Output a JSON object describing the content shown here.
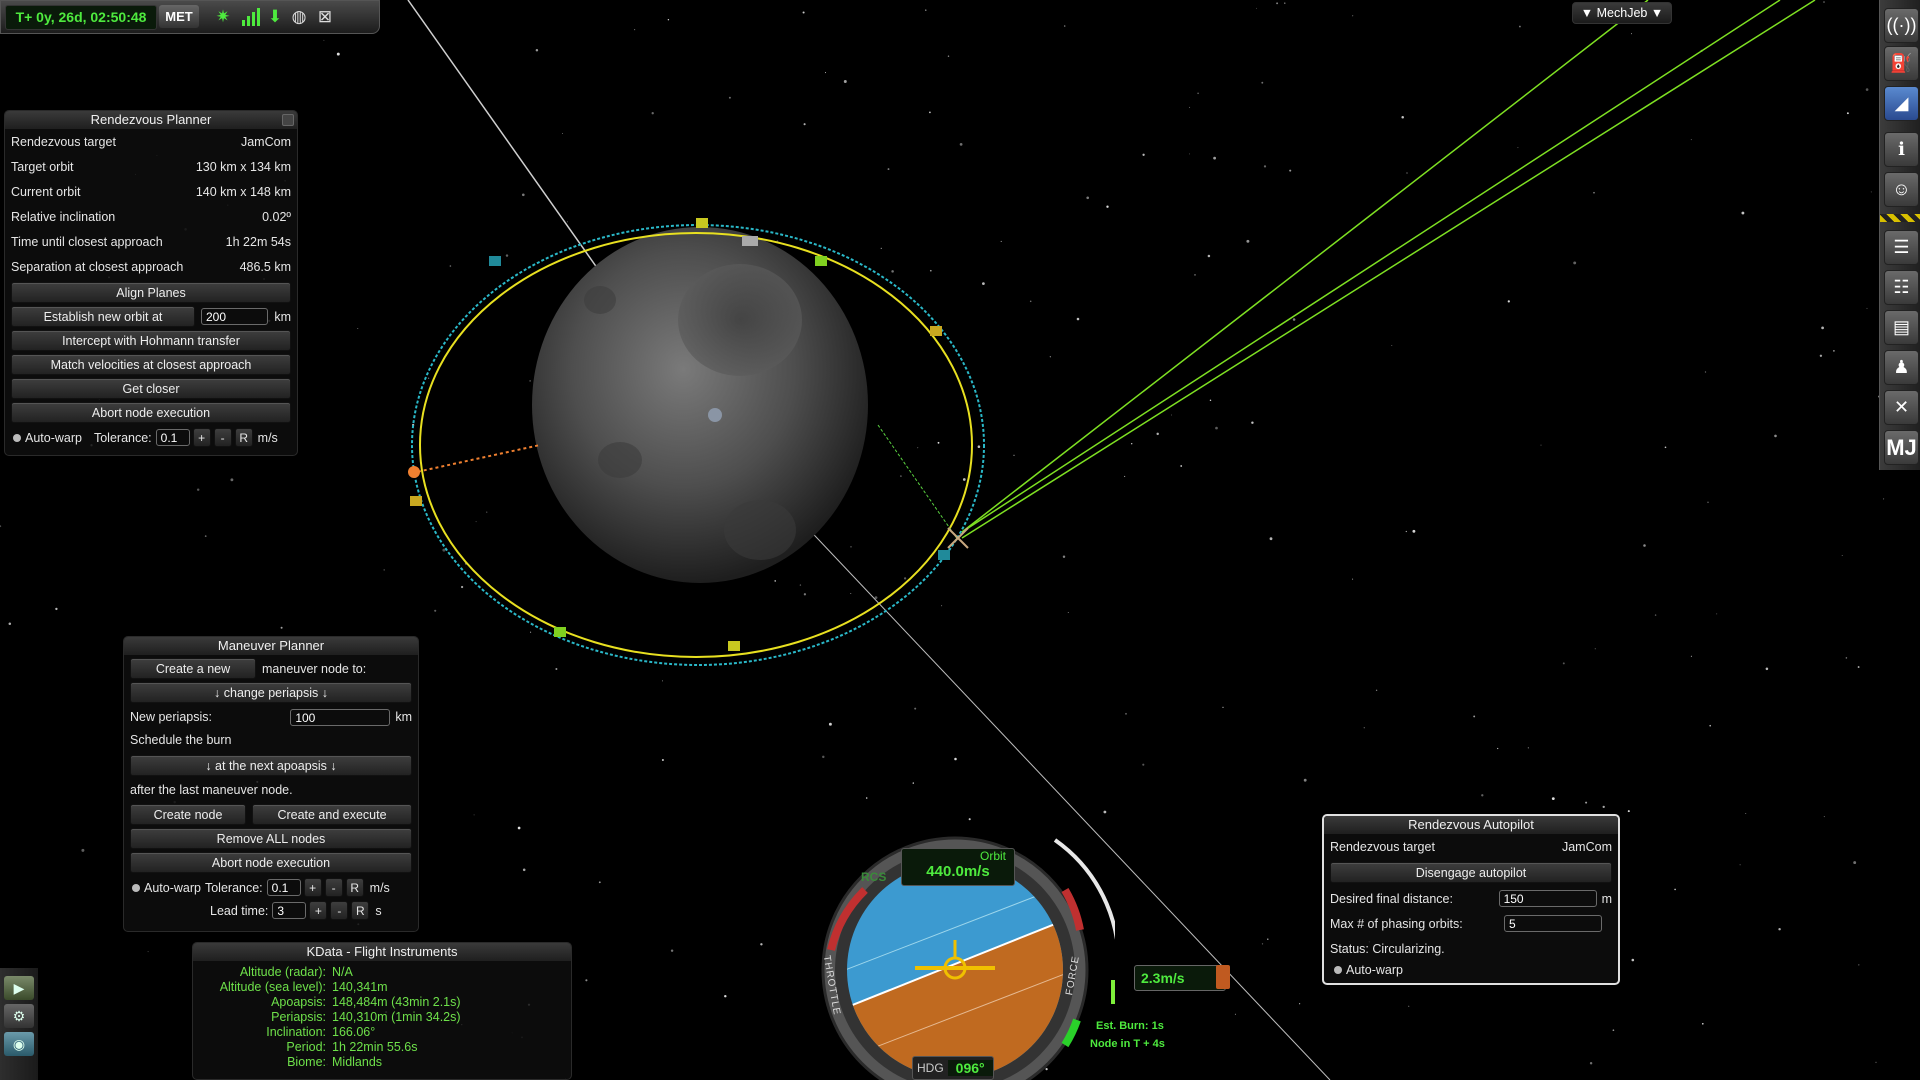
{
  "topbar": {
    "met_time": "T+ 0y, 26d, 02:50:48",
    "met_label": "MET",
    "icons": [
      "antenna-signal-icon",
      "signal-bars-icon",
      "download-arrow-icon",
      "planet-view-icon",
      "map-navigation-icon"
    ]
  },
  "mechjeb_tab": {
    "label": "▼ MechJeb ▼"
  },
  "rendezvous_planner": {
    "title": "Rendezvous Planner",
    "rows": [
      {
        "label": "Rendezvous target",
        "value": "JamCom"
      },
      {
        "label": "Target orbit",
        "value": "130 km x 134 km"
      },
      {
        "label": "Current orbit",
        "value": "140 km x 148 km"
      },
      {
        "label": "Relative inclination",
        "value": "0.02º"
      },
      {
        "label": "Time until closest approach",
        "value": "1h 22m 54s"
      },
      {
        "label": "Separation at closest approach",
        "value": "486.5 km"
      }
    ],
    "align_planes": "Align Planes",
    "establish_label": "Establish new orbit at",
    "establish_value": "200",
    "establish_unit": "km",
    "hohmann": "Intercept with Hohmann transfer",
    "match_velocities": "Match velocities at closest approach",
    "get_closer": "Get closer",
    "abort": "Abort node execution",
    "autowarp": "Auto-warp",
    "tolerance_label": "Tolerance:",
    "tolerance_value": "0.1",
    "plus": "+",
    "minus": "-",
    "reset": "R",
    "tolerance_unit": "m/s"
  },
  "maneuver_planner": {
    "title": "Maneuver Planner",
    "create_new": "Create a new",
    "node_to": "maneuver node to:",
    "change_periapsis": "↓ change periapsis ↓",
    "new_periapsis_label": "New periapsis:",
    "new_periapsis_value": "100",
    "new_periapsis_unit": "km",
    "schedule": "Schedule the burn",
    "next_apoapsis": "↓ at the next apoapsis ↓",
    "after_last": "after the last maneuver node.",
    "create_node": "Create node",
    "create_execute": "Create and execute",
    "remove_all": "Remove ALL nodes",
    "abort": "Abort node execution",
    "autowarp": "Auto-warp",
    "tolerance_label": "Tolerance:",
    "tolerance_value": "0.1",
    "plus": "+",
    "minus": "-",
    "reset": "R",
    "tolerance_unit": "m/s",
    "lead_label": "Lead time:",
    "lead_value": "3",
    "lead_unit": "s"
  },
  "rendezvous_autopilot": {
    "title": "Rendezvous Autopilot",
    "target_label": "Rendezvous target",
    "target_value": "JamCom",
    "disengage": "Disengage autopilot",
    "final_distance_label": "Desired final distance:",
    "final_distance_value": "150",
    "final_distance_unit": "m",
    "phasing_label": "Max # of phasing orbits:",
    "phasing_value": "5",
    "status": "Status: Circularizing.",
    "autowarp": "Auto-warp"
  },
  "kdata": {
    "title": "KData - Flight Instruments",
    "rows": [
      {
        "label": "Altitude (radar):",
        "value": "N/A"
      },
      {
        "label": "Altitude (sea level):",
        "value": "140,341m"
      },
      {
        "label": "Apoapsis:",
        "value": "148,484m (43min 2.1s)"
      },
      {
        "label": "Periapsis:",
        "value": "140,310m (1min 34.2s)"
      },
      {
        "label": "Inclination:",
        "value": "166.06°"
      },
      {
        "label": "Period:",
        "value": "1h 22min 55.6s"
      },
      {
        "label": "Biome:",
        "value": "Midlands"
      }
    ]
  },
  "navball": {
    "mode": "Orbit",
    "speed": "440.0m/s",
    "rcs": "RCS",
    "throttle_label": "THROTTLE",
    "force_label": "FORCE",
    "heading_label": "HDG",
    "heading_value": "096°",
    "burn_dv": "2.3m/s",
    "est_burn": "Est. Burn: 1s",
    "node_in": "Node in T + 4s"
  },
  "colors": {
    "met_green": "#4eea3e",
    "orbit_yellow": "#e8e020",
    "target_orbit_cyan": "#2ab8c8",
    "trajectory_green": "#7ee022",
    "navball_sky": "#3c9ad0",
    "navball_ground": "#c06a20",
    "kdata_green": "#6ee04a"
  },
  "rightbar_icons": [
    "antenna-icon",
    "fuel-icon",
    "aero-icon",
    "info-icon",
    "crew-icon",
    "notes-icon",
    "list-icon",
    "clipboard-icon",
    "mic-icon",
    "crossed-tools-icon",
    "mechjeb-icon"
  ],
  "leftbar_icons": [
    "staging-icon",
    "crew-portrait-icon",
    "camera-icon"
  ],
  "mj_label": "MJ"
}
